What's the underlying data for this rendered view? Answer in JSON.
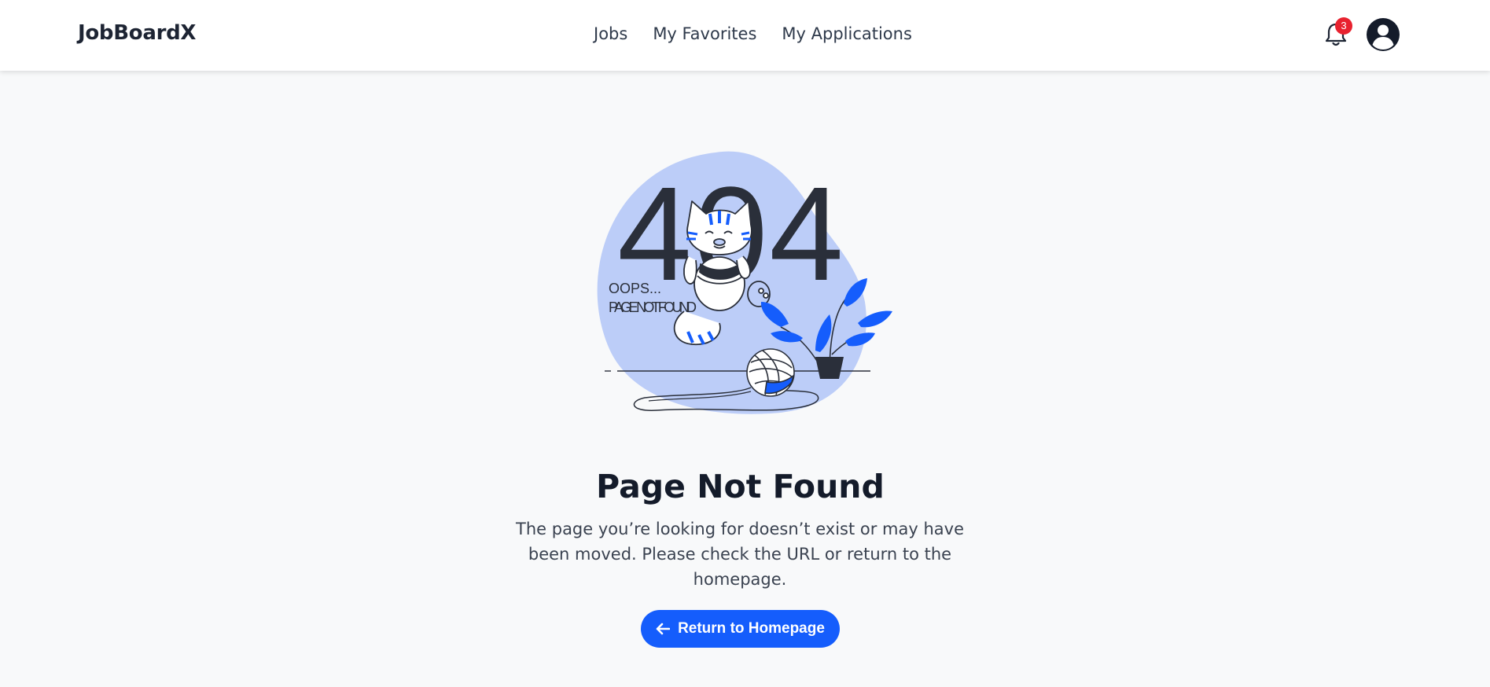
{
  "app": {
    "brand": "JobBoardX"
  },
  "nav": {
    "items": [
      {
        "label": "Jobs"
      },
      {
        "label": "My Favorites"
      },
      {
        "label": "My Applications"
      }
    ]
  },
  "header": {
    "notifications": {
      "icon": "bell-icon",
      "count": "3"
    },
    "user": {
      "icon": "user-avatar-icon"
    }
  },
  "illustration": {
    "big_text": "404",
    "oops_line1": "OOPS...",
    "oops_line2": "PAGE NOT FOUND"
  },
  "content": {
    "title": "Page Not Found",
    "message": "The page you’re looking for doesn’t exist or may have been moved. Please check the URL or return to the homepage.",
    "button_label": "Return to Homepage",
    "button_icon": "arrow-left-icon"
  },
  "colors": {
    "accent": "#155dfc",
    "badge": "#e8222f",
    "blob": "#bccdf8",
    "background": "#f8f9fa"
  }
}
